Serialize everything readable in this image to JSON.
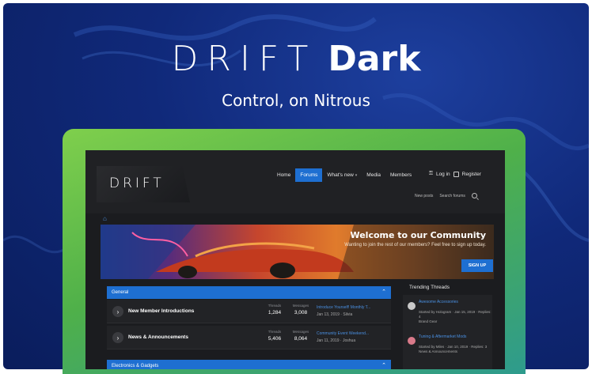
{
  "hero": {
    "brand_logo": "DRIFT",
    "brand_suffix": "Dark",
    "tagline": "Control, on Nitrous"
  },
  "colors": {
    "hero_bg": "#10297a",
    "monitor_bezel": "#5ab64a",
    "forum_bg": "#1b1c1f",
    "accent": "#1e6fd1",
    "link": "#4a90e2"
  },
  "forum": {
    "logo": "DRIFT",
    "nav": [
      {
        "label": "Home",
        "active": false
      },
      {
        "label": "Forums",
        "active": true
      },
      {
        "label": "What's new",
        "active": false
      },
      {
        "label": "Media",
        "active": false
      },
      {
        "label": "Members",
        "active": false
      }
    ],
    "login": "Log in",
    "register": "Register",
    "sub_nav": [
      "New posts",
      "Search forums"
    ],
    "breadcrumb_icon": "home-icon",
    "banner": {
      "title": "Welcome to our Community",
      "subtitle": "Wanting to join the rest of our members? Feel free to sign up today.",
      "button": "SIGN UP"
    },
    "categories": [
      {
        "title": "General",
        "nodes": [
          {
            "title": "New Member Introductions",
            "threads_label": "Threads",
            "threads": "1,284",
            "messages_label": "Messages",
            "messages": "3,008",
            "latest_title": "Introduce Yourself! Monthly T...",
            "latest_meta": "Jan 13, 2019 · Silvia"
          },
          {
            "title": "News & Announcements",
            "threads_label": "Threads",
            "threads": "5,406",
            "messages_label": "Messages",
            "messages": "8,064",
            "latest_title": "Community Event Weekend...",
            "latest_meta": "Jan 11, 2019 · Joshua"
          }
        ]
      },
      {
        "title": "Electronics & Gadgets",
        "nodes": []
      }
    ],
    "sidebar": {
      "title": "Trending Threads",
      "threads": [
        {
          "title": "Awesome Accessories",
          "meta": "Started by Hologram · Jan 15, 2019 · Replies: 4",
          "forum": "Brand Gear"
        },
        {
          "title": "Tuning & Aftermarket Mods",
          "meta": "Started by Miles · Jan 10, 2019 · Replies: 3",
          "forum": "News & Announcements"
        }
      ]
    }
  }
}
